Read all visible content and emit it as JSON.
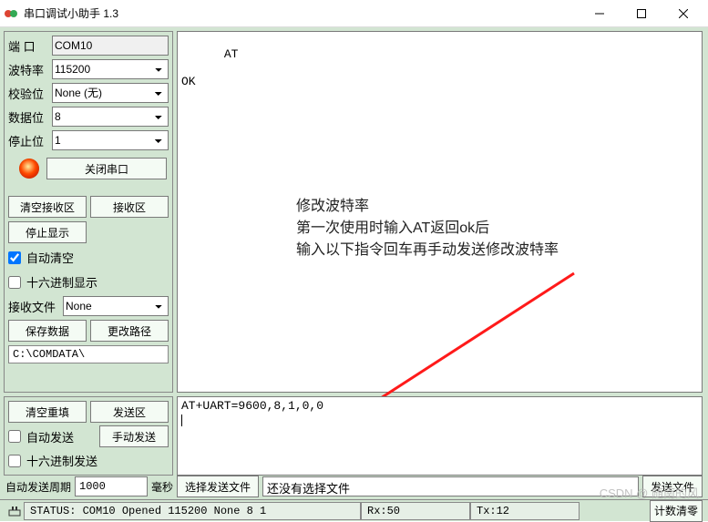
{
  "window": {
    "title": "串口调试小助手 1.3"
  },
  "port": {
    "label": "端  口",
    "value": "COM10"
  },
  "baud": {
    "label": "波特率",
    "value": "115200"
  },
  "parity": {
    "label": "校验位",
    "value": "None (无)"
  },
  "databits": {
    "label": "数据位",
    "value": "8"
  },
  "stopbits": {
    "label": "停止位",
    "value": "1"
  },
  "buttons": {
    "close_port": "关闭串口",
    "clear_rx": "清空接收区",
    "rx_area": "接收区",
    "stop_display": "停止显示",
    "save_data": "保存数据",
    "change_path": "更改路径",
    "clear_refill": "清空重填",
    "tx_area": "发送区",
    "manual_send": "手动发送",
    "select_send_file": "选择发送文件",
    "send_file": "发送文件",
    "count_clear": "计数清零"
  },
  "checks": {
    "auto_clear": "自动清空",
    "hex_display": "十六进制显示",
    "auto_send": "自动发送",
    "hex_send": "十六进制发送",
    "auto_clear_checked": true,
    "hex_display_checked": false,
    "auto_send_checked": false,
    "hex_send_checked": false
  },
  "rx_file": {
    "label": "接收文件",
    "value": "None"
  },
  "save_path": "C:\\COMDATA\\",
  "rx_text": "AT\n\nOK",
  "tx_text": "AT+UART=9600,8,1,0,0",
  "auto_period": {
    "label": "自动发送周期",
    "value": "1000",
    "unit": "毫秒"
  },
  "file_none": "还没有选择文件",
  "status": {
    "text": "STATUS: COM10 Opened 115200 None  8 1",
    "rx": "Rx:50",
    "tx": "Tx:12"
  },
  "annotation": {
    "l1": "修改波特率",
    "l2": "第一次使用时输入AT返回ok后",
    "l3": "输入以下指令回车再手动发送修改波特率"
  },
  "watermark": "CSDN @ 随南的风"
}
